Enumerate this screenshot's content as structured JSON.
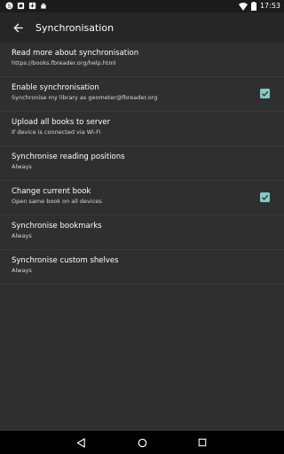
{
  "status_bar": {
    "time": "17:53",
    "left_icons": [
      "skype-icon",
      "sim-icon",
      "download-icon",
      "android-icon"
    ],
    "right_icons": [
      "wifi-icon",
      "battery-icon"
    ]
  },
  "app_bar": {
    "title": "Synchronisation",
    "back_icon": "arrow-left-icon"
  },
  "settings": [
    {
      "title": "Read more about synchronisation",
      "subtitle": "https://books.fbreader.org/help.html",
      "checkbox": null
    },
    {
      "title": "Enable synchronisation",
      "subtitle": "Synchronise my library as geometer@fbreader.org",
      "checkbox": true
    },
    {
      "title": "Upload all books to server",
      "subtitle": "If device is connected via Wi-Fi",
      "checkbox": null
    },
    {
      "title": "Synchronise reading positions",
      "subtitle": "Always",
      "checkbox": null
    },
    {
      "title": "Change current book",
      "subtitle": "Open same book on all devices",
      "checkbox": true
    },
    {
      "title": "Synchronise bookmarks",
      "subtitle": "Always",
      "checkbox": null
    },
    {
      "title": "Synchronise custom shelves",
      "subtitle": "Always",
      "checkbox": null
    }
  ],
  "colors": {
    "background": "#2f2f2f",
    "app_bar": "#262626",
    "accent": "#80cbc4",
    "nav_bar": "#000000"
  },
  "nav_bar": {
    "icons": [
      "back-triangle-icon",
      "home-circle-icon",
      "recents-square-icon"
    ]
  }
}
